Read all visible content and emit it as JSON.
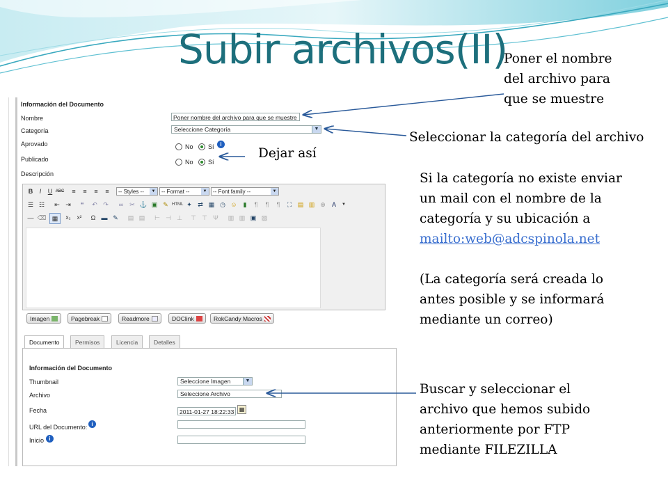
{
  "slide": {
    "title": "Subir archivos(II)",
    "notes": {
      "nombre": [
        "Poner el nombre",
        "del archivo para",
        "que se muestre"
      ],
      "categoria": "Seleccionar la categoría del archivo",
      "dejar": "Dejar así",
      "mail_lines": [
        "Si la categoría no existe enviar",
        "un mail con el nombre de la",
        "categoría y su ubicación a"
      ],
      "mail_link": "mailto:web@adcspinola.net",
      "creada_lines": [
        "(La categoría será creada lo",
        "antes posible y se informará",
        "mediante un correo)"
      ],
      "buscar_lines": [
        "Buscar y seleccionar el",
        "archivo que hemos subido",
        "anteriormente por FTP",
        "mediante FILEZILLA"
      ]
    }
  },
  "form": {
    "header": "Información del Documento",
    "nombre_label": "Nombre",
    "nombre_value": "Poner nombre del archivo para que se muestre",
    "categoria_label": "Categoría",
    "categoria_value": "Seleccione Categoría",
    "aprovado_label": "Aprovado",
    "publicado_label": "Publicado",
    "no": "No",
    "si": "Sí",
    "descripcion_label": "Descripción",
    "toolbar": {
      "bold": "B",
      "italic": "I",
      "underline": "U",
      "strike": "ABC",
      "styles": "-- Styles --",
      "format": "-- Format --",
      "fontfamily": "-- Font family --"
    },
    "editor_buttons": [
      "Imagen",
      "Pagebreak",
      "Readmore",
      "DOClink",
      "RokCandy Macros"
    ],
    "tabs": [
      "Documento",
      "Permisos",
      "Licencia",
      "Detalles"
    ],
    "doc": {
      "header": "Información del Documento",
      "thumbnail_label": "Thumbnail",
      "thumbnail_value": "Seleccione Imagen",
      "archivo_label": "Archivo",
      "archivo_value": "Seleccione Archivo",
      "fecha_label": "Fecha",
      "fecha_value": "2011-01-27 18:22:33",
      "url_label": "URL del Documento:",
      "inicio_label": "Inicio"
    }
  },
  "colors": {
    "title": "#1d6f7c",
    "link": "#3a6fcf",
    "arrow": "#2a5a9a"
  }
}
